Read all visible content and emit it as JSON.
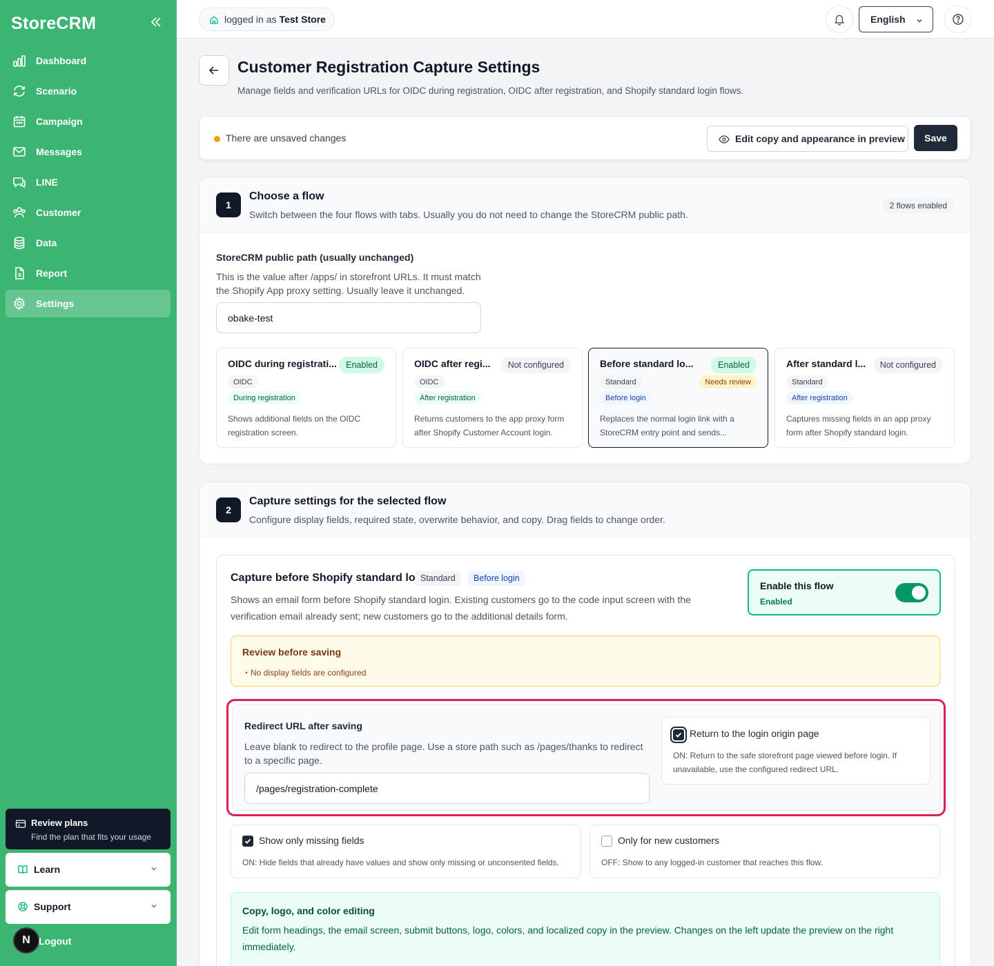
{
  "app": {
    "brand": "StoreCRM"
  },
  "sidebar": {
    "items": [
      {
        "label": "Dashboard",
        "icon": "bar-chart-icon"
      },
      {
        "label": "Scenario",
        "icon": "refresh-icon"
      },
      {
        "label": "Campaign",
        "icon": "calendar-icon"
      },
      {
        "label": "Messages",
        "icon": "mail-icon"
      },
      {
        "label": "LINE",
        "icon": "chat-icon"
      },
      {
        "label": "Customer",
        "icon": "users-icon"
      },
      {
        "label": "Data",
        "icon": "database-icon"
      },
      {
        "label": "Report",
        "icon": "file-icon"
      },
      {
        "label": "Settings",
        "icon": "gear-icon",
        "active": true
      }
    ],
    "review_plans": {
      "title": "Review plans",
      "subtitle": "Find the plan that fits your usage"
    },
    "learn": "Learn",
    "support": "Support",
    "logout": "Logout",
    "avatar": "N"
  },
  "topbar": {
    "login_prefix": "logged in as",
    "store": "Test Store",
    "language": "English"
  },
  "header": {
    "title": "Customer Registration Capture Settings",
    "subtitle": "Manage fields and verification URLs for OIDC during registration, OIDC after registration, and Shopify standard login flows."
  },
  "unsaved": {
    "text": "There are unsaved changes",
    "edit_label": "Edit copy and appearance in preview",
    "save_label": "Save"
  },
  "step1": {
    "number": "1",
    "title": "Choose a flow",
    "subtitle": "Switch between the four flows with tabs. Usually you do not need to change the StoreCRM public path.",
    "badge": "2 flows enabled",
    "path_label": "StoreCRM public path (usually unchanged)",
    "path_help": "This is the value after /apps/ in storefront URLs. It must match the Shopify App proxy setting. Usually leave it unchanged.",
    "path_value": "obake-test",
    "flows": [
      {
        "title": "OIDC during registrati...",
        "status": "Enabled",
        "tag1": "OIDC",
        "tag2": "During registration",
        "desc": "Shows additional fields on the OIDC registration screen."
      },
      {
        "title": "OIDC after regi...",
        "status": "Not configured",
        "tag1": "OIDC",
        "tag2": "After registration",
        "desc": "Returns customers to the app proxy form after Shopify Customer Account login."
      },
      {
        "title": "Before standard lo...",
        "status": "Enabled",
        "tag1": "Standard",
        "tag2": "Before login",
        "extra": "Needs review",
        "desc": "Replaces the normal login link with a StoreCRM entry point and sends..."
      },
      {
        "title": "After standard l...",
        "status": "Not configured",
        "tag1": "Standard",
        "tag2": "After registration",
        "desc": "Captures missing fields in an app proxy form after Shopify standard login."
      }
    ]
  },
  "step2": {
    "number": "2",
    "title": "Capture settings for the selected flow",
    "subtitle": "Configure display fields, required state, overwrite behavior, and copy. Drag fields to change order.",
    "card_title": "Capture before Shopify standard login",
    "tag1": "Standard",
    "tag2": "Before login",
    "card_desc": "Shows an email form before Shopify standard login. Existing customers go to the code input screen with the verification email already sent; new customers go to the additional details form.",
    "toggle_title": "Enable this flow",
    "toggle_state": "Enabled",
    "review_title": "Review before saving",
    "review_item": "・No display fields are configured",
    "redirect_label": "Redirect URL after saving",
    "redirect_help": "Leave blank to redirect to the profile page. Use a store path such as /pages/thanks to redirect to a specific page.",
    "redirect_value": "/pages/registration-complete",
    "origin_label": "Return to the login origin page",
    "origin_desc": "ON: Return to the safe storefront page viewed before login. If unavailable, use the configured redirect URL.",
    "missing_label": "Show only missing fields",
    "missing_desc": "ON: Hide fields that already have values and show only missing or unconsented fields.",
    "new_label": "Only for new customers",
    "new_desc": "OFF: Show to any logged-in customer that reaches this flow.",
    "copy_title": "Copy, logo, and color editing",
    "copy_desc": "Edit form headings, the email screen, submit buttons, logo, colors, and localized copy in the preview. Changes on the left update the preview on the right immediately."
  }
}
